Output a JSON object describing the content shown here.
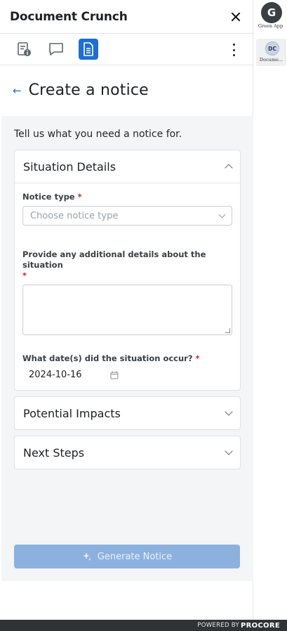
{
  "panel": {
    "title": "Document Crunch"
  },
  "toolbar": {
    "buttons": [
      {
        "icon": "document-info-icon",
        "active": false
      },
      {
        "icon": "chat-bubble-icon",
        "active": false
      },
      {
        "icon": "notice-document-icon",
        "active": true
      }
    ],
    "more_icon": "kebab-menu-icon"
  },
  "page": {
    "title": "Create a notice",
    "intro": "Tell us what you need a notice for."
  },
  "sections": {
    "situation": {
      "title": "Situation Details",
      "expanded": true,
      "notice_type_label": "Notice type",
      "notice_type_placeholder": "Choose notice type",
      "details_label": "Provide any additional details about the situation",
      "details_value": "",
      "date_label": "What date(s) did the situation occur?",
      "date_value": "2024-10-16",
      "required_mark": "*"
    },
    "impacts": {
      "title": "Potential Impacts",
      "expanded": false
    },
    "next_steps": {
      "title": "Next Steps",
      "expanded": false
    }
  },
  "actions": {
    "generate_label": "Generate Notice"
  },
  "sidebar": {
    "apps": [
      {
        "initial": "G",
        "label": "Green App"
      },
      {
        "initial": "DC",
        "label": "Docume...",
        "active": true
      }
    ]
  },
  "footer": {
    "powered_by": "POWERED BY",
    "brand": "PROCORE"
  },
  "colors": {
    "accent": "#1e6fd0",
    "button_disabled": "#8db1de",
    "required": "#d92626",
    "footer_bg": "#303336"
  }
}
